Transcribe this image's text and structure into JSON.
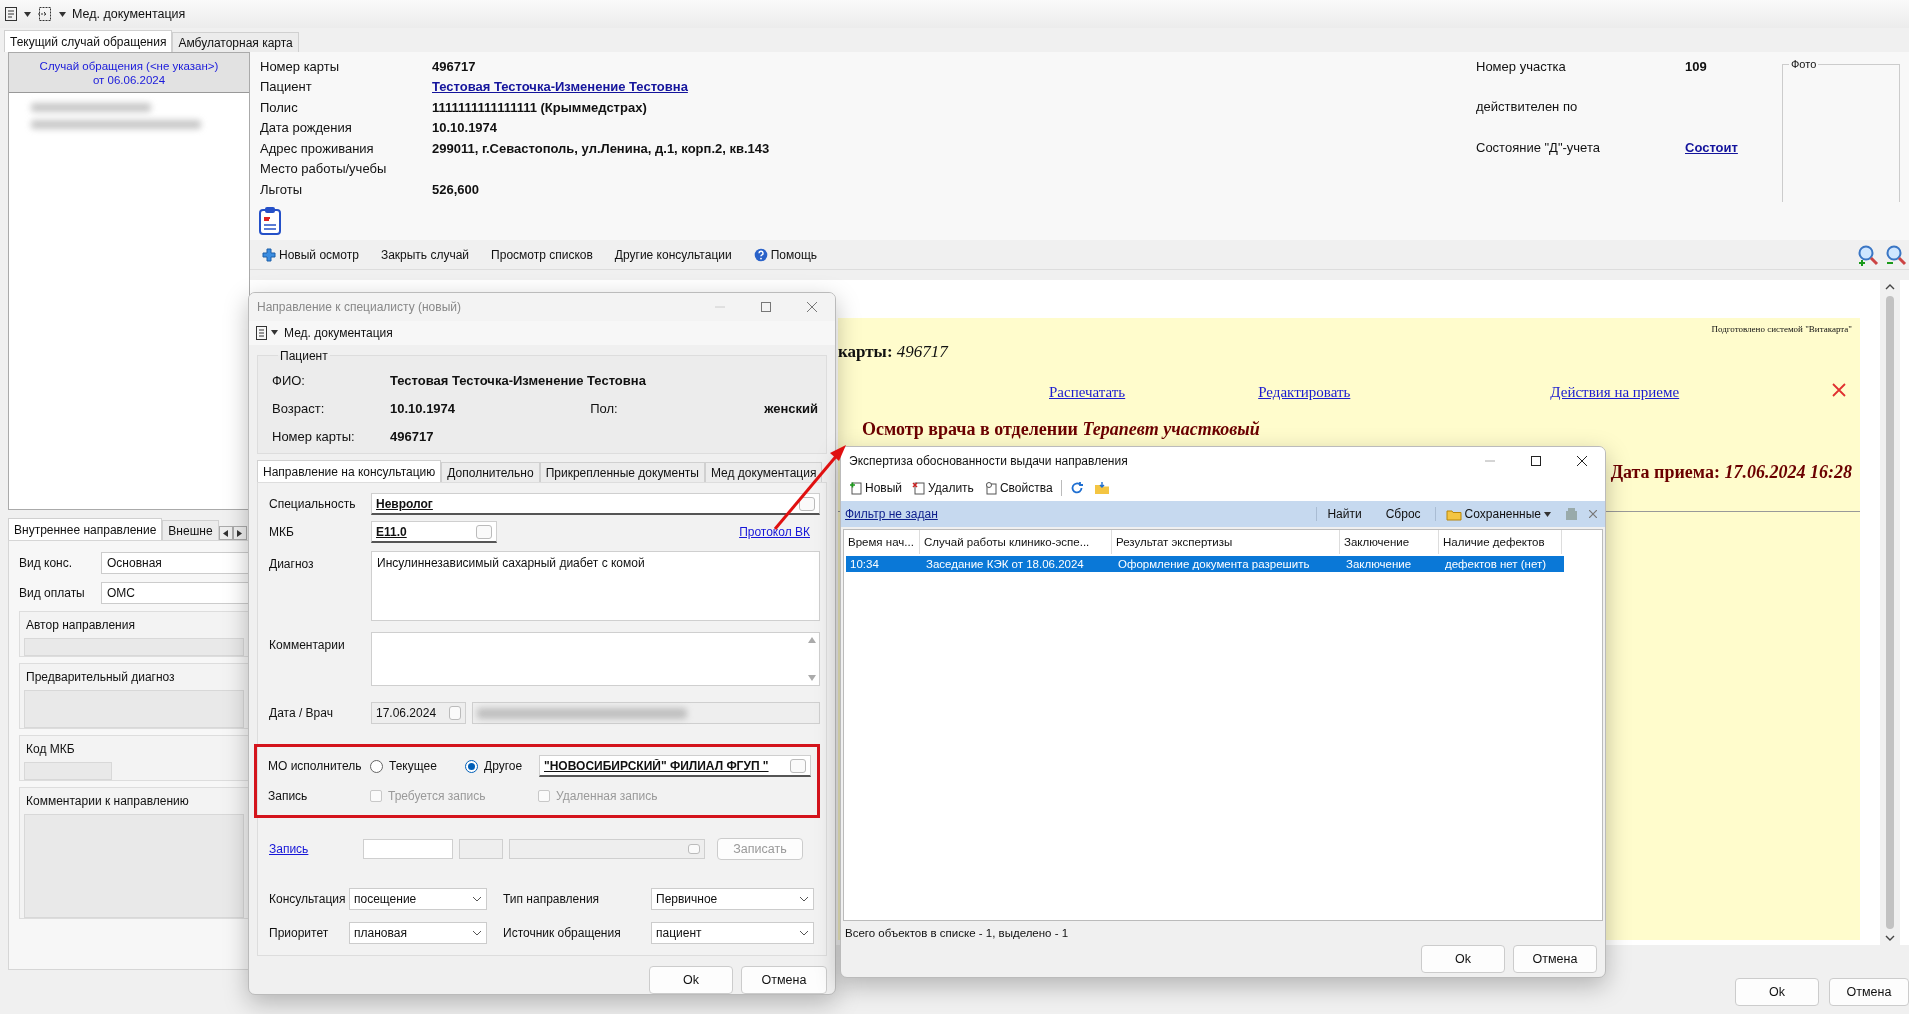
{
  "toolbar": {
    "menu": "Мед. документация"
  },
  "main_tabs": [
    {
      "label": "Текущий случай обращения",
      "selected": true
    },
    {
      "label": "Амбулаторная карта",
      "selected": false
    }
  ],
  "case": {
    "title": "Случай обращения (<не указан>)",
    "date": "от 06.06.2024"
  },
  "patient_fields": [
    {
      "label": "Номер карты",
      "value": "496717",
      "kind": "text"
    },
    {
      "label": "Пациент",
      "value": "Тестовая Тесточка-Изменение Тестовна",
      "kind": "link"
    },
    {
      "label": "Полис",
      "value": " 1111111111111111 (Крыммедстрах)",
      "kind": "text"
    },
    {
      "label": "Дата рождения",
      "value": "10.10.1974",
      "kind": "text"
    },
    {
      "label": "Адрес проживания",
      "value": "299011, г.Севастополь, ул.Ленина, д.1, корп.2, кв.143",
      "kind": "text"
    },
    {
      "label": "Место работы/учебы"
    },
    {
      "label": "Льготы",
      "value": "526,600",
      "kind": "text"
    }
  ],
  "district_fields": [
    {
      "label": "Номер участка",
      "value": "109",
      "kind": "text"
    },
    {
      "label": "действителен по"
    },
    {
      "label": "Состояние \"Д\"-учета",
      "value": "Состоит",
      "kind": "link"
    }
  ],
  "photo": {
    "label": "Фото"
  },
  "actions": [
    {
      "label": "Новый осмотр",
      "kind": "plus"
    },
    {
      "label": "Закрыть случай",
      "kind": "plain"
    },
    {
      "label": "Просмотр списков",
      "kind": "plain"
    },
    {
      "label": "Другие консультации",
      "kind": "plain"
    },
    {
      "label": "Помощь",
      "kind": "help"
    }
  ],
  "left_tabs": [
    {
      "label": "Внутреннее направление",
      "selected": true
    },
    {
      "label": "Внешне",
      "selected": false
    }
  ],
  "left_fields": [
    {
      "label": "Вид конс.",
      "value": "Основная"
    },
    {
      "label": "Вид оплаты",
      "value": "ОМС"
    }
  ],
  "left_sections": [
    {
      "label": "Автор направления",
      "kind": "line"
    },
    {
      "label": "Предварительный диагноз",
      "kind": "area"
    },
    {
      "label": "Код МКБ",
      "kind": "short"
    },
    {
      "label": "Комментарии к направлению",
      "kind": "tall"
    }
  ],
  "document": {
    "prepared": "Подготовлено системой \"Витакарта\"",
    "card_label": "карты:",
    "card_number": "496717",
    "links": [
      "Распечатать",
      "Редактировать",
      "Действия на приеме"
    ],
    "heading": "Осмотр врача в отделении",
    "department": "Терапевт участковый",
    "date_label": "Дата приема:",
    "date_value": "17.06.2024 16:28"
  },
  "footer_buttons": [
    "Ok",
    "Отмена"
  ],
  "referral_dialog": {
    "title": "Направление к специалисту (новый)",
    "menu": "Мед. документация",
    "patient_group": "Пациент",
    "fio": {
      "label": "ФИО:",
      "value": "Тестовая Тесточка-Изменение Тестовна"
    },
    "age": {
      "label": "Возраст:",
      "value": "10.10.1974"
    },
    "sex": {
      "label": "Пол:",
      "value": "женский"
    },
    "card": {
      "label": "Номер карты:",
      "value": "496717"
    },
    "tabs": [
      {
        "label": "Направление на консультацию",
        "selected": true
      },
      {
        "label": "Дополнительно",
        "selected": false
      },
      {
        "label": "Прикрепленные документы",
        "selected": false
      },
      {
        "label": "Мед документация",
        "selected": false
      }
    ],
    "specialty": {
      "label": "Специальность",
      "value": "Невролог"
    },
    "mkb": {
      "label": "МКБ",
      "value": "E11.0"
    },
    "protocol_link": "Протокол ВК",
    "diagnosis": {
      "label": "Диагноз",
      "value": "Инсулиннезависимый сахарный диабет с комой"
    },
    "comments": {
      "label": "Комментарии"
    },
    "date_doctor": {
      "label": "Дата / Врач",
      "date": "17.06.2024"
    },
    "mo": {
      "label": "МО исполнитель",
      "options": [
        {
          "label": "Текущее",
          "selected": false
        },
        {
          "label": "Другое",
          "selected": true
        }
      ],
      "value": "\"НОВОСИБИРСКИЙ\" ФИЛИАЛ ФГУП \""
    },
    "booking": {
      "label": "Запись",
      "checks": [
        {
          "label": "Требуется запись",
          "checked": false,
          "disabled": true
        },
        {
          "label": "Удаленная запись",
          "checked": false,
          "disabled": true
        }
      ]
    },
    "record_link": "Запись",
    "record_button": {
      "label": "Записать",
      "disabled": true
    },
    "selects": [
      {
        "label": "Консультация",
        "value": "посещение"
      },
      {
        "label": "Тип направления",
        "value": "Первичное"
      },
      {
        "label": "Приоритет",
        "value": "плановая"
      },
      {
        "label": "Источник обращения",
        "value": "пациент"
      }
    ],
    "buttons": [
      "Ok",
      "Отмена"
    ]
  },
  "expertise_dialog": {
    "title": "Экспертиза обоснованности выдачи направления",
    "toolbar": [
      {
        "label": "Новый",
        "kind": "new"
      },
      {
        "label": "Удалить",
        "kind": "delete"
      },
      {
        "label": "Свойства",
        "kind": "props"
      },
      {
        "kind": "refresh"
      },
      {
        "kind": "folder"
      }
    ],
    "filter_link": "Фильтр не задан",
    "find": "Найти",
    "reset": "Сброс",
    "saved": "Сохраненные",
    "columns": [
      "Время нач...",
      "Случай работы клинико-эспе...",
      "Результат экспертизы",
      "Заключение",
      "Наличие дефектов"
    ],
    "rows": [
      {
        "cells": [
          "10:34",
          "Заседание КЭК от 18.06.2024",
          "Оформление документа разрешить",
          "Заключение",
          "дефектов нет (нет)"
        ],
        "selected": true
      }
    ],
    "status": "Всего объектов в списке - 1, выделено - 1",
    "buttons": [
      "Ok",
      "Отмена"
    ]
  }
}
